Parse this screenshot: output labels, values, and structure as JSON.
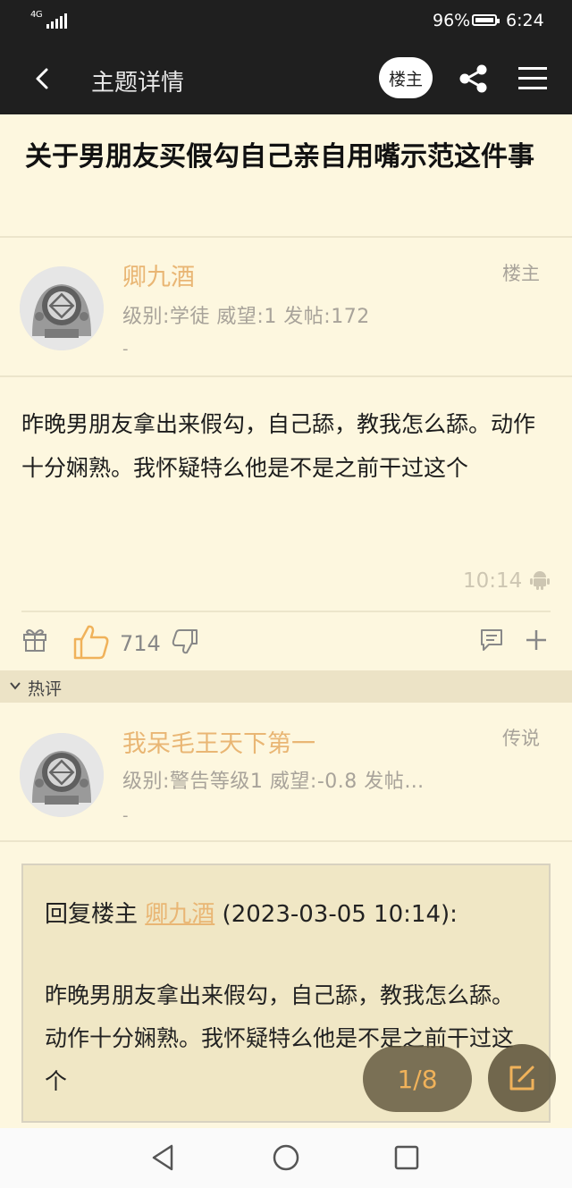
{
  "status_bar": {
    "network": "4G",
    "battery": "96%",
    "time": "6:24"
  },
  "header": {
    "title": "主题详情",
    "op_button": "楼主"
  },
  "topic": {
    "title": "关于男朋友买假勾自己亲自用嘴示范这件事"
  },
  "post": {
    "author": "卿九酒",
    "role": "楼主",
    "stats": "级别:学徒    威望:1    发帖:172",
    "extra": "-",
    "body": "昨晚男朋友拿出来假勾，自己舔，教我怎么舔。动作十分娴熟。我怀疑特么他是不是之前干过这个",
    "time": "10:14",
    "like_count": "714"
  },
  "hot_section": {
    "label": "热评"
  },
  "reply": {
    "author": "我呆毛王天下第一",
    "role": "传说",
    "stats": "级别:警告等级1    威望:-0.8    发帖…",
    "extra": "-",
    "quote_prefix": "回复楼主 ",
    "quote_name": "卿九酒",
    "quote_date": " (2023-03-05 10:14):",
    "quote_body": "昨晚男朋友拿出来假勾，自己舔，教我怎么舔。动作十分娴熟。我怀疑特么他是不是之前干过这个"
  },
  "pagination": {
    "label": "1/8"
  },
  "colors": {
    "accent": "#e9b674",
    "background": "#fdf7df",
    "header": "#1f1f1f"
  }
}
